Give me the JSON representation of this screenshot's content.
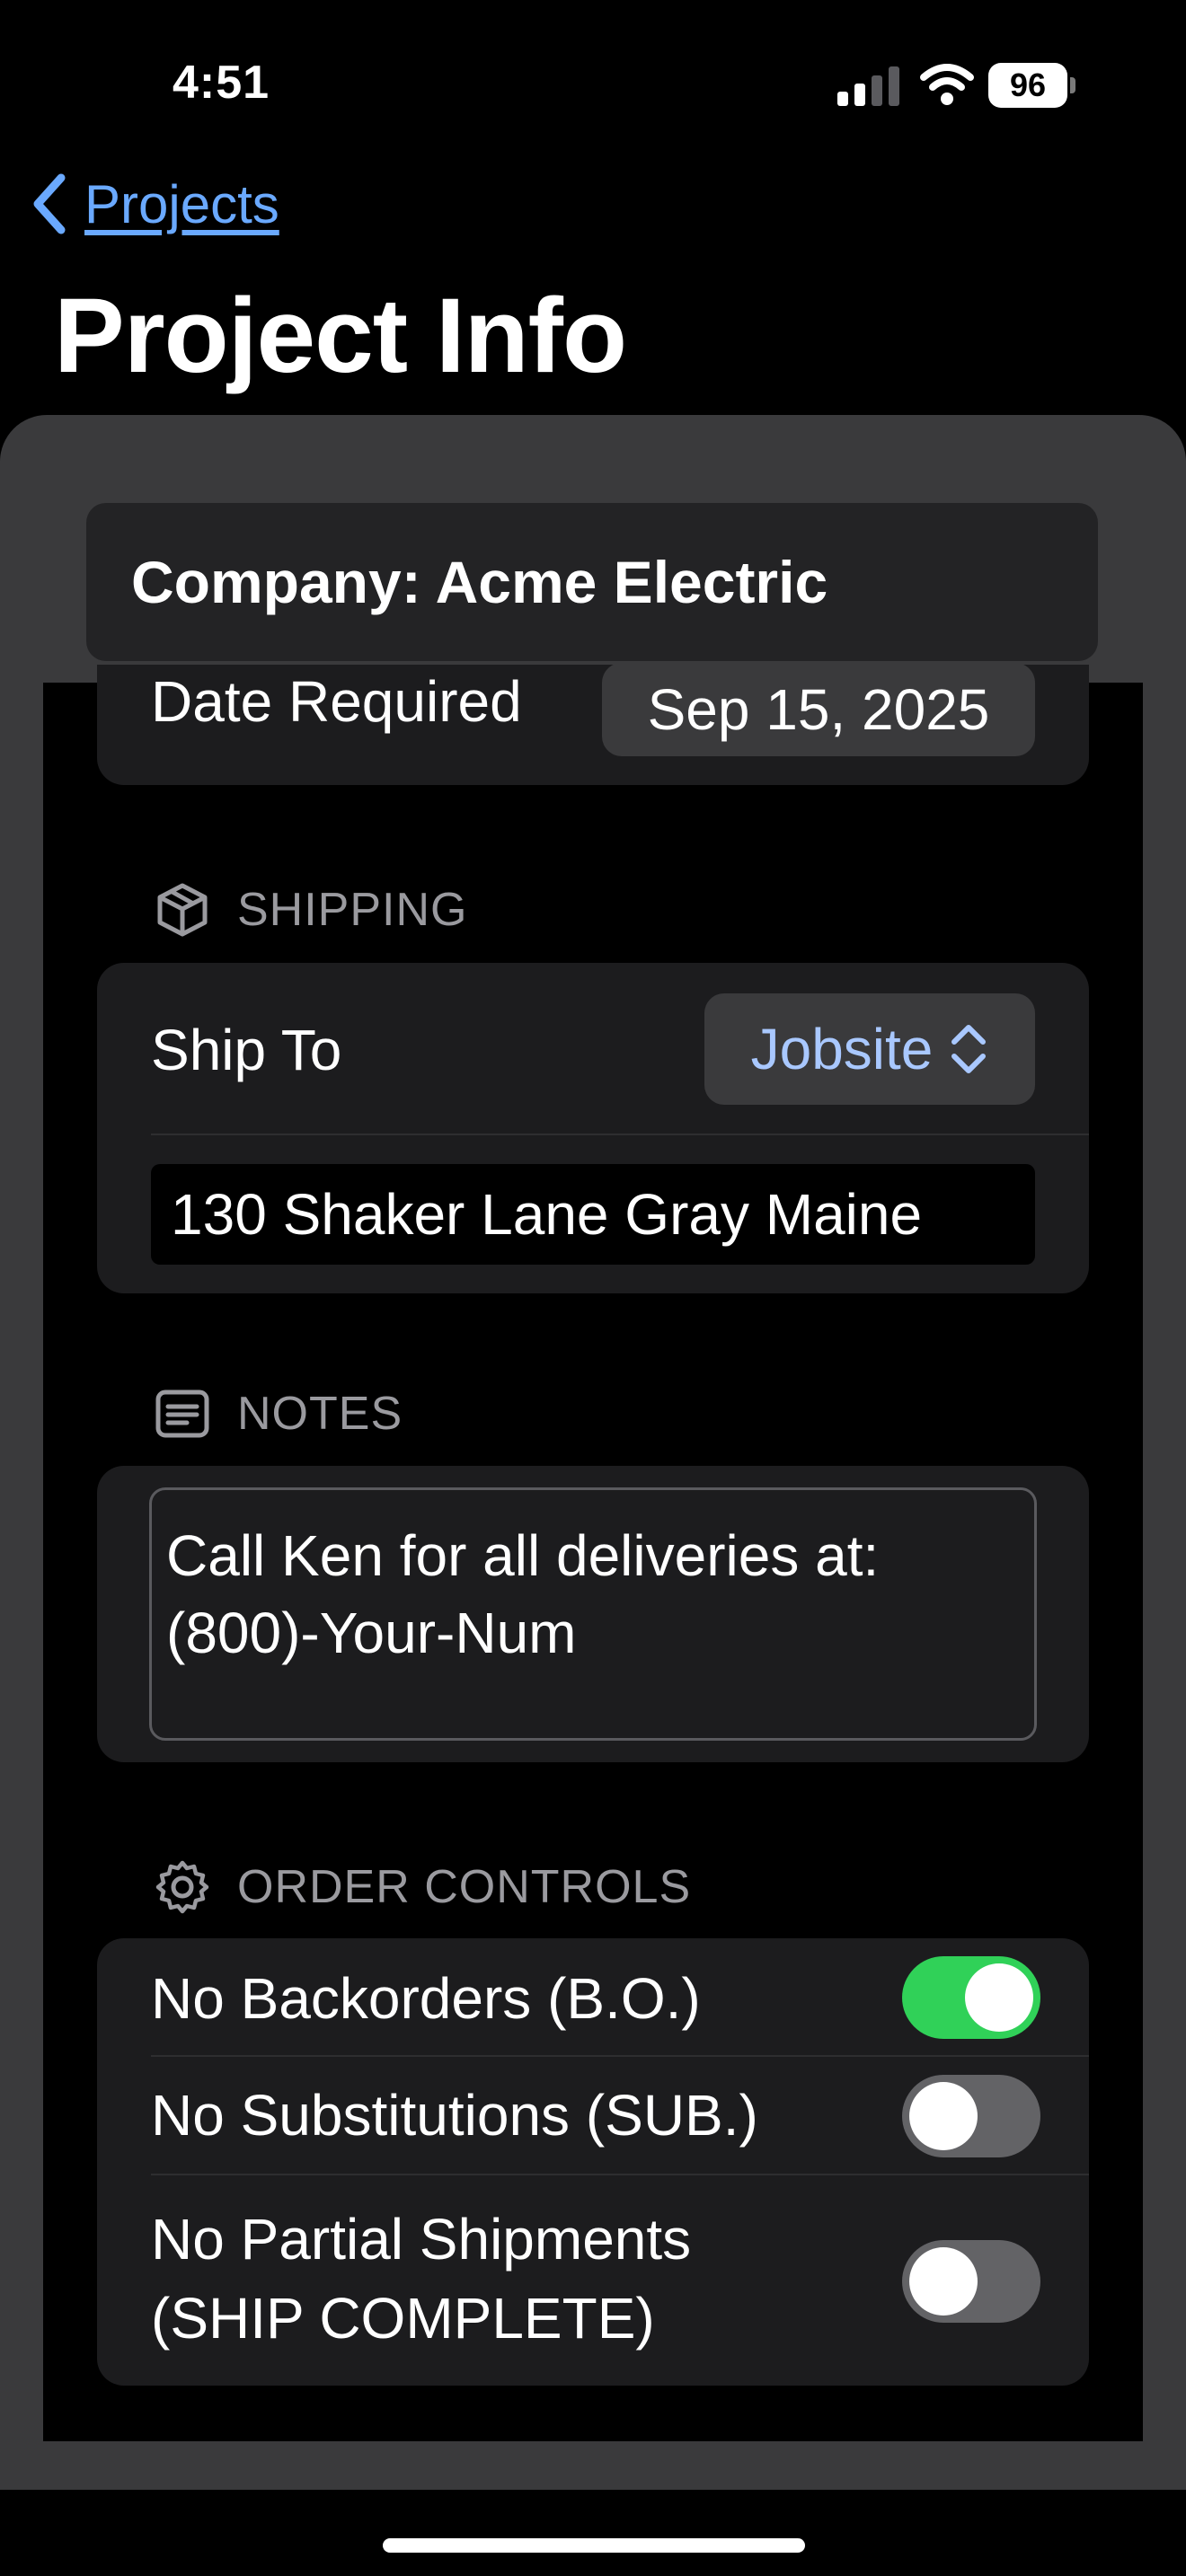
{
  "status_bar": {
    "time": "4:51",
    "battery": "96"
  },
  "nav": {
    "back_label": "Projects",
    "title": "Project Info"
  },
  "company": {
    "label": "Company: Acme Electric"
  },
  "date": {
    "label": "Date Required",
    "value": "Sep 15, 2025"
  },
  "shipping": {
    "header": "SHIPPING",
    "ship_to_label": "Ship To",
    "ship_to_value": "Jobsite",
    "address": "130 Shaker Lane Gray Maine"
  },
  "notes": {
    "header": "NOTES",
    "line1": "Call Ken for all deliveries at:",
    "line2": "(800)-Your-Num"
  },
  "order_controls": {
    "header": "ORDER CONTROLS",
    "items": [
      {
        "label": "No Backorders (B.O.)",
        "on": true
      },
      {
        "label": "No Substitutions (SUB.)",
        "on": false
      },
      {
        "label_line1": "No Partial Shipments",
        "label_line2": "(SHIP COMPLETE)",
        "on": false
      }
    ]
  },
  "colors": {
    "accent": "#6aa9ff",
    "toggle_on": "#30d158",
    "toggle_off": "#636366"
  }
}
